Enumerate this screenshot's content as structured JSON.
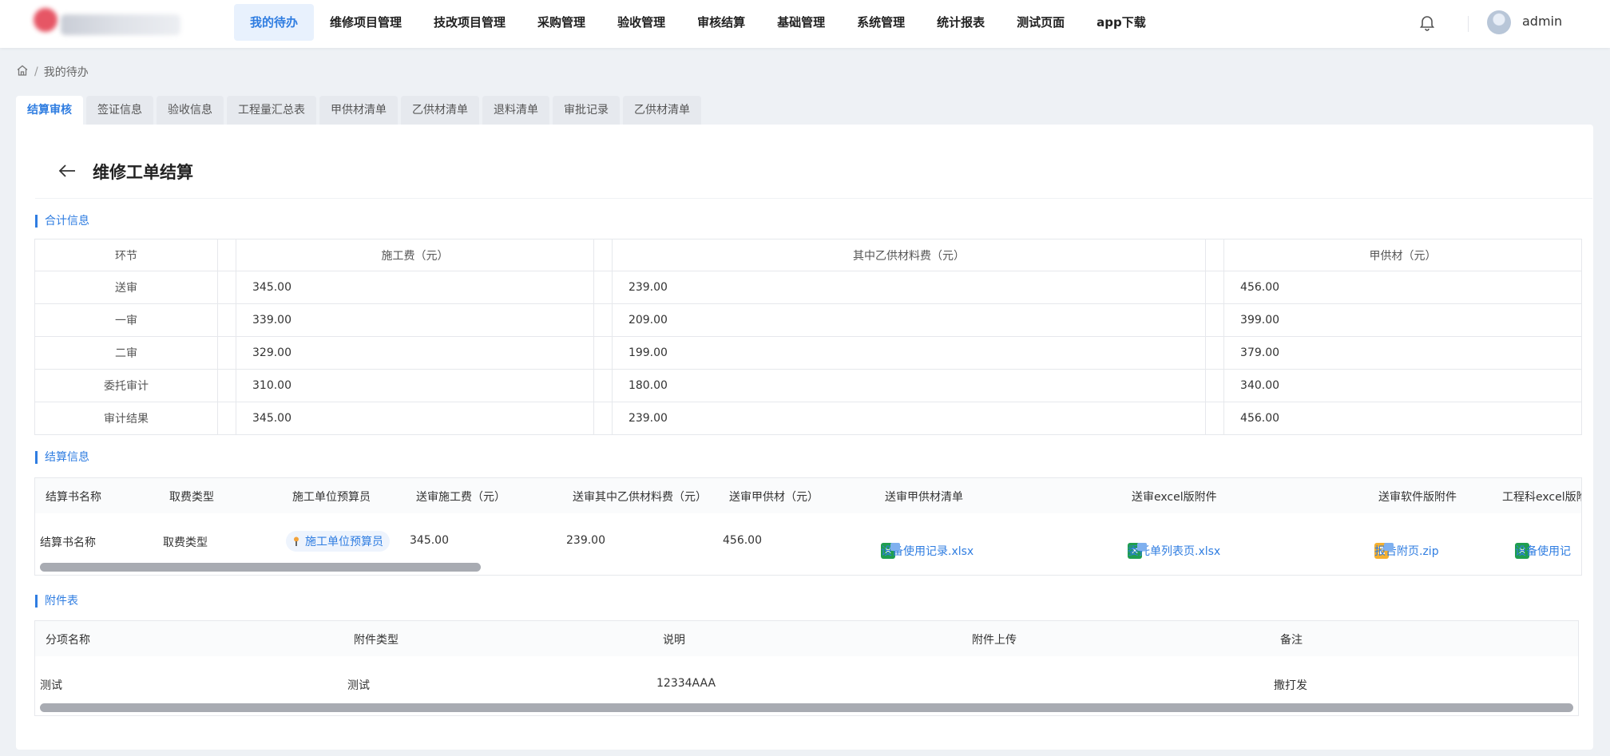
{
  "nav": {
    "items": [
      "我的待办",
      "维修项目管理",
      "技改项目管理",
      "采购管理",
      "验收管理",
      "审核结算",
      "基础管理",
      "系统管理",
      "统计报表",
      "测试页面",
      "app下载"
    ],
    "active_index": 0,
    "user_name": "admin"
  },
  "breadcrumb": {
    "current": "我的待办"
  },
  "tabs": {
    "items": [
      "结算审核",
      "签证信息",
      "验收信息",
      "工程量汇总表",
      "甲供材清单",
      "乙供材清单",
      "退料清单",
      "审批记录",
      "乙供材清单"
    ],
    "active_index": 0
  },
  "page": {
    "title": "维修工单结算"
  },
  "summary": {
    "section_title": "合计信息",
    "headers": [
      "环节",
      "施工费（元）",
      "其中乙供材料费（元）",
      "甲供材（元）"
    ],
    "rows": [
      [
        "送审",
        "345.00",
        "239.00",
        "456.00"
      ],
      [
        "一审",
        "339.00",
        "209.00",
        "399.00"
      ],
      [
        "二审",
        "329.00",
        "199.00",
        "379.00"
      ],
      [
        "委托审计",
        "310.00",
        "180.00",
        "340.00"
      ],
      [
        "审计结果",
        "345.00",
        "239.00",
        "456.00"
      ]
    ]
  },
  "settlement": {
    "section_title": "结算信息",
    "headers": [
      "结算书名称",
      "取费类型",
      "施工单位预算员",
      "送审施工费（元）",
      "送审其中乙供材料费（元）",
      "送审甲供材（元）",
      "送审甲供材清单",
      "送审excel版附件",
      "送审软件版附件",
      "工程科excel版附"
    ],
    "row": {
      "name": "结算书名称",
      "fee_type": "取费类型",
      "budgeter": "施工单位预算员",
      "construction_fee": "345.00",
      "b_material_fee": "239.00",
      "a_material": "456.00",
      "file1": "设备使用记录.xlsx",
      "file2": "委托单列表页.xlsx",
      "file3": "报告附页.zip",
      "file4": "设备使用记"
    }
  },
  "attachments": {
    "section_title": "附件表",
    "headers": [
      "分项名称",
      "附件类型",
      "说明",
      "附件上传",
      "备注"
    ],
    "row": [
      "测试",
      "测试",
      "12334AAA",
      "",
      "撒打发"
    ]
  },
  "colors": {
    "accent": "#2f7de1",
    "excel": "#1f9e4f",
    "zip": "#f5b02f"
  }
}
